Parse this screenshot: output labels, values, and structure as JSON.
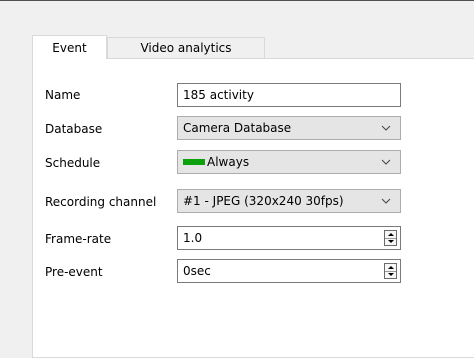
{
  "tabs": [
    {
      "label": "Event",
      "active": true
    },
    {
      "label": "Video analytics",
      "active": false
    }
  ],
  "form": {
    "name": {
      "label": "Name",
      "value": "185 activity"
    },
    "database": {
      "label": "Database",
      "value": "Camera Database"
    },
    "schedule": {
      "label": "Schedule",
      "value": "Always",
      "swatch_color": "#0ca10c"
    },
    "recording_channel": {
      "label": "Recording channel",
      "value": "#1 - JPEG (320x240 30fps)"
    },
    "frame_rate": {
      "label": "Frame-rate",
      "value": "1.0"
    },
    "pre_event": {
      "label": "Pre-event",
      "value": "0sec"
    }
  },
  "icons": {
    "dropdown": "chevron-down-icon",
    "spinner": "spin-arrows-icon"
  }
}
